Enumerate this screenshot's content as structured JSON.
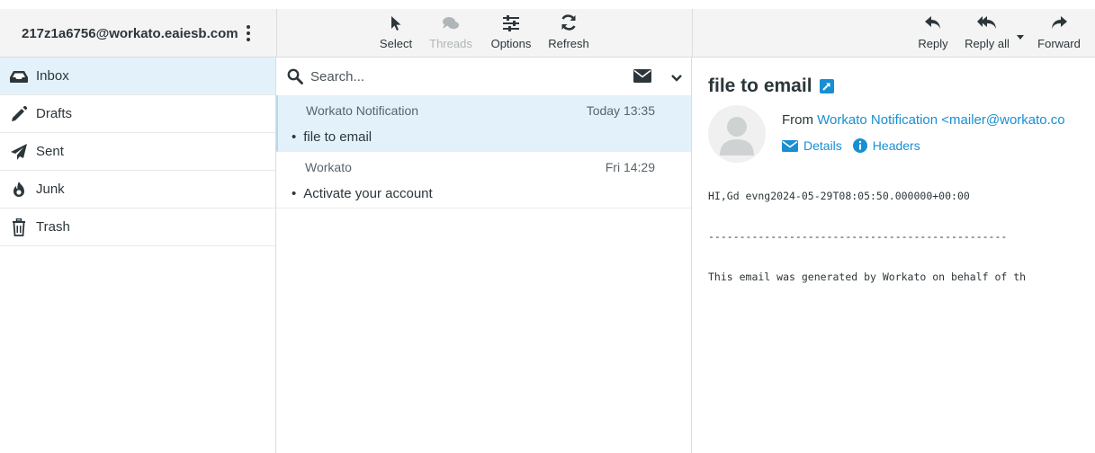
{
  "header": {
    "account": "217z1a6756@workato.eaiesb.com"
  },
  "toolbar": {
    "select": "Select",
    "threads": "Threads",
    "options": "Options",
    "refresh": "Refresh",
    "reply": "Reply",
    "reply_all": "Reply all",
    "forward": "Forward"
  },
  "folders": [
    {
      "label": "Inbox",
      "icon": "inbox-icon"
    },
    {
      "label": "Drafts",
      "icon": "pencil-icon"
    },
    {
      "label": "Sent",
      "icon": "paper-plane-icon"
    },
    {
      "label": "Junk",
      "icon": "fire-icon"
    },
    {
      "label": "Trash",
      "icon": "trash-icon"
    }
  ],
  "search": {
    "placeholder": "Search..."
  },
  "messages": [
    {
      "from": "Workato Notification",
      "date": "Today 13:35",
      "subject": "file to email"
    },
    {
      "from": "Workato",
      "date": "Fri 14:29",
      "subject": "Activate your account"
    }
  ],
  "preview": {
    "subject": "file to email",
    "from_label": "From",
    "from_address": "Workato Notification <mailer@workato.co",
    "details": "Details",
    "headers": "Headers",
    "body_line1": "HI,Gd evng2024-05-29T08:05:50.000000+00:00",
    "body_separator": "------------------------------------------------",
    "body_line2": "This email was generated by Workato on behalf of th"
  },
  "colors": {
    "accent": "#188fd2",
    "selected_bg": "#e3f2fa",
    "text": "#2c363a"
  }
}
